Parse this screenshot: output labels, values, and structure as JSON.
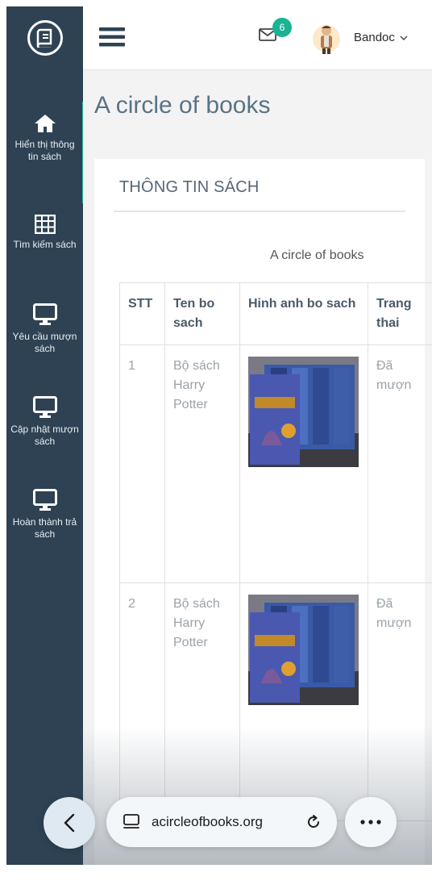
{
  "header": {
    "mail_count": "6",
    "user_name": "Bandoc"
  },
  "sidebar": {
    "items": [
      {
        "label": "Hiển thị thông tin sách",
        "icon": "home-icon"
      },
      {
        "label": "Tìm kiếm sách",
        "icon": "grid-table-icon"
      },
      {
        "label": "Yêu cầu mượn sách",
        "icon": "monitor-icon"
      },
      {
        "label": "Cập nhật mượn sách",
        "icon": "monitor-icon"
      },
      {
        "label": "Hoàn thành trả sách",
        "icon": "monitor-icon"
      }
    ]
  },
  "main": {
    "page_title": "A circle of books",
    "card_title": "THÔNG TIN SÁCH",
    "table_caption": "A circle of books",
    "columns": [
      "STT",
      "Ten bo sach",
      "Hinh anh bo sach",
      "Trang thai"
    ],
    "rows": [
      {
        "stt": "1",
        "name": "Bộ sách Harry Potter",
        "status": "Đã mượn"
      },
      {
        "stt": "2",
        "name": "Bộ sách Harry Potter",
        "status": "Đã mượn"
      }
    ]
  },
  "browser": {
    "url": "acircleofbooks.org"
  },
  "colors": {
    "sidebar_bg": "#2e4253",
    "accent": "#25b89b",
    "badge": "#1bb395",
    "title": "#5b7384"
  }
}
